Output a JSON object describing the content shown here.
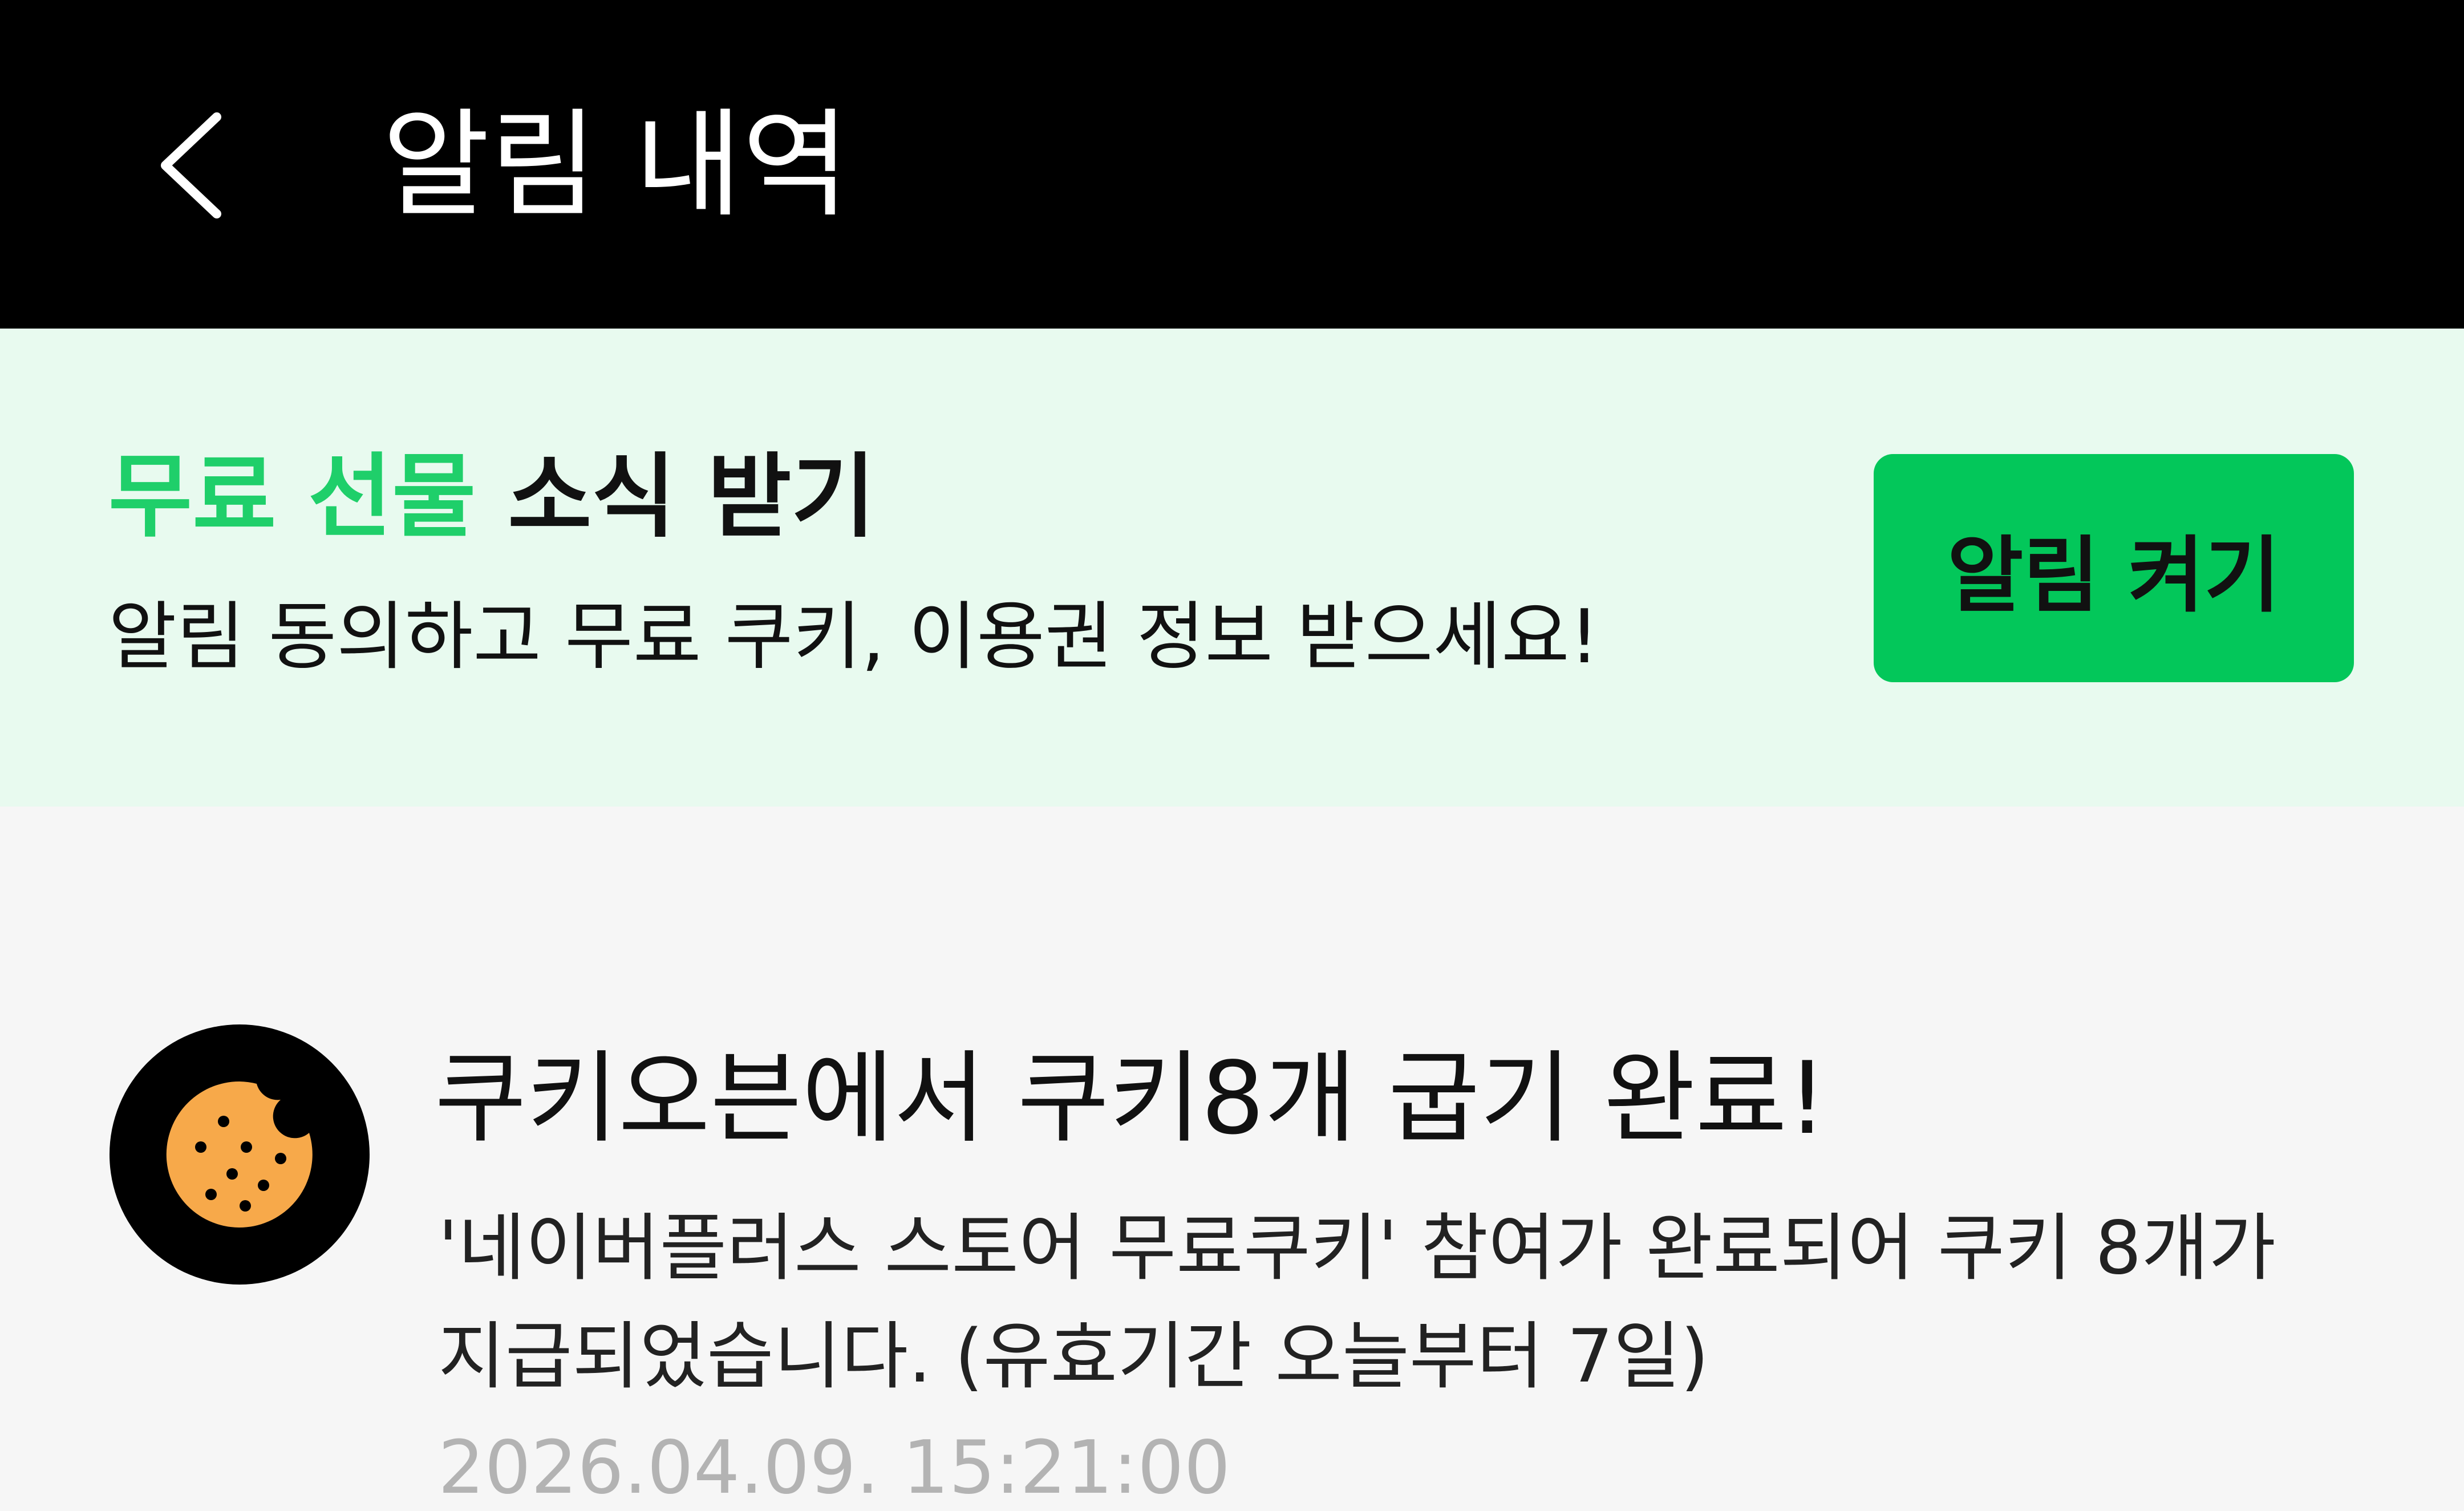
{
  "header": {
    "back_icon": "chevron-left-icon",
    "title": "알림 내역",
    "background": "#000000",
    "text_color": "#ffffff"
  },
  "promo": {
    "title_accent": "무료 선물",
    "title_rest": " 소식 받기",
    "subtitle": "알림 동의하고 무료 쿠키, 이용권 정보 받으세요!",
    "button_label": "알림 켜기",
    "accent_color": "#1fcf6a",
    "button_color": "#03c75a",
    "background": "#e8faef"
  },
  "notifications": [
    {
      "icon": "cookie-icon",
      "title": "쿠키오븐에서 쿠키8개 굽기 완료!",
      "body": "'네이버플러스 스토어 무료쿠키' 참여가 완료되어 쿠키 8개가 지급되었습니다. (유효기간 오늘부터 7일)",
      "date": "2026.04.09. 15:21:00"
    }
  ]
}
